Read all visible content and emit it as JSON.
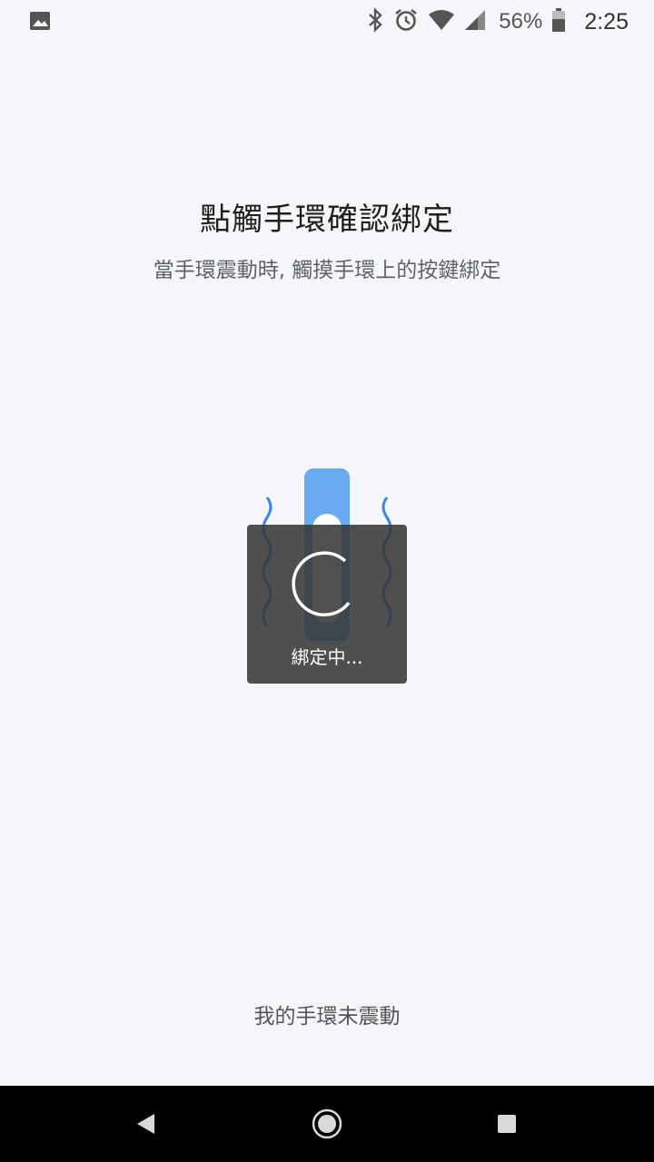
{
  "status_bar": {
    "battery_percent": "56%",
    "time": "2:25",
    "icons": [
      "image-icon",
      "bluetooth-icon",
      "alarm-icon",
      "wifi-icon",
      "cell-signal-icon",
      "battery-icon"
    ]
  },
  "main": {
    "title": "點觸手環確認綁定",
    "subtitle": "當手環震動時, 觸摸手環上的按鍵綁定"
  },
  "loading": {
    "text": "綁定中..."
  },
  "footer": {
    "not_vibrating_link": "我的手環未震動"
  },
  "nav_bar": {
    "icons": [
      "back-icon",
      "home-icon",
      "recents-icon"
    ]
  },
  "colors": {
    "background": "#f4f6f9",
    "band_blue": "#6aaaf0",
    "wave_blue": "#3d87d8",
    "dialog_bg": "#363636"
  }
}
